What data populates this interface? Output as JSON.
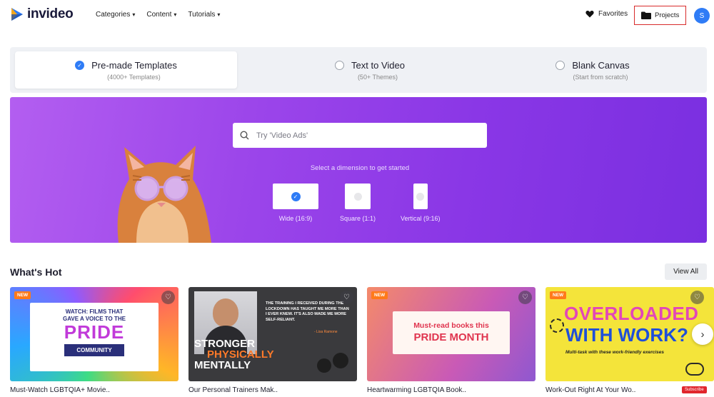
{
  "header": {
    "logo_text": "invideo",
    "nav": [
      {
        "label": "Categories"
      },
      {
        "label": "Content"
      },
      {
        "label": "Tutorials"
      }
    ],
    "favorites_label": "Favorites",
    "projects_label": "Projects",
    "avatar_initial": "S"
  },
  "modes": [
    {
      "title": "Pre-made Templates",
      "subtitle": "(4000+ Templates)",
      "selected": true
    },
    {
      "title": "Text to Video",
      "subtitle": "(50+ Themes)",
      "selected": false
    },
    {
      "title": "Blank Canvas",
      "subtitle": "(Start from scratch)",
      "selected": false
    }
  ],
  "hero": {
    "search_placeholder": "Try 'Video Ads'",
    "dimension_prompt": "Select a dimension to get started",
    "dimensions": [
      {
        "label": "Wide (16:9)",
        "selected": true
      },
      {
        "label": "Square (1:1)",
        "selected": false
      },
      {
        "label": "Vertical (9:16)",
        "selected": false
      }
    ]
  },
  "whats_hot": {
    "title": "What's Hot",
    "view_all": "View All",
    "cards": [
      {
        "caption": "Must-Watch LGBTQIA+ Movie..",
        "new": true,
        "lines": [
          "WATCH: FILMS THAT",
          "GAVE A VOICE TO THE",
          "PRIDE",
          "COMMUNITY"
        ]
      },
      {
        "caption": "Our Personal Trainers Mak..",
        "new": false,
        "quote": "THE TRAINING I RECEIVED DURING THE LOCKDOWN HAS TAUGHT ME MORE THAN I EVER KNEW. IT'S ALSO MADE ME MORE SELF-RELIANT.",
        "quote_author": "- Lisa Ramone",
        "headline": [
          "STRONGER",
          "PHYSICALLY",
          "MENTALLY"
        ]
      },
      {
        "caption": "Heartwarming LGBTQIA Book..",
        "new": true,
        "lines": [
          "Must-read books this",
          "PRIDE MONTH"
        ]
      },
      {
        "caption": "Work-Out Right At Your Wo..",
        "new": true,
        "lines": [
          "OVERLOADED",
          "WITH WORK?",
          "Multi-task with these work-friendly exercises"
        ]
      }
    ],
    "subscribe_badge": "Subscribe"
  },
  "colors": {
    "accent": "#2f7cf6",
    "hero_purple": "#8a37e6",
    "projects_highlight": "#d82b2b",
    "new_badge": "#ff7a1a"
  }
}
